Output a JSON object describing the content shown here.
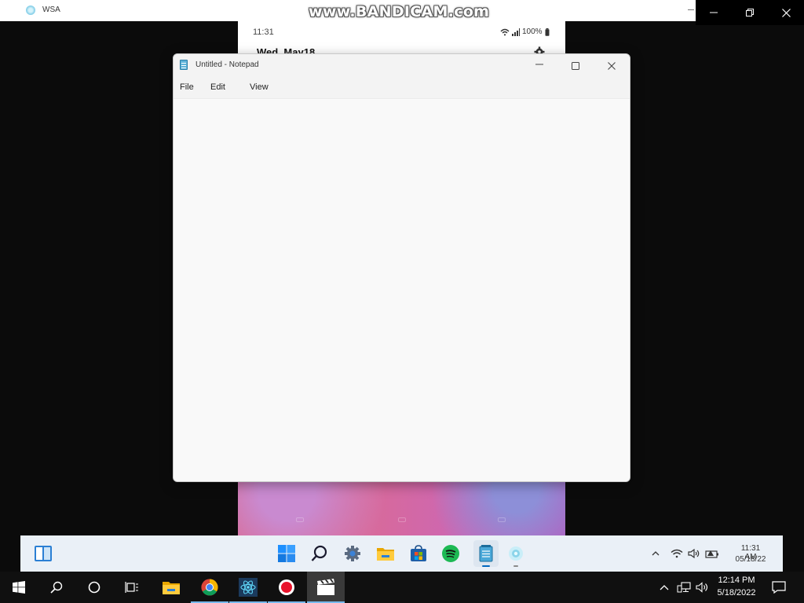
{
  "watermark": "www.BANDICAM.com",
  "wsa": {
    "title": "WSA"
  },
  "android": {
    "time": "11:31",
    "battery": "100%",
    "date": "Wed, May18"
  },
  "notepad": {
    "title": "Untitled - Notepad",
    "menu": [
      "File",
      "Edit",
      "View"
    ],
    "content": ""
  },
  "w11_taskbar": {
    "icons": [
      "widgets-icon",
      "start-icon",
      "search-icon",
      "settings-icon",
      "file-explorer-icon",
      "store-icon",
      "spotify-icon",
      "notepad-icon",
      "wsa-icon"
    ],
    "clock_time": "11:31 AM",
    "clock_date": "05/18/22"
  },
  "w10_taskbar": {
    "clock_time": "12:14 PM",
    "clock_date": "5/18/2022",
    "colors": {
      "accent": "#76b9ed",
      "background": "#101010"
    }
  }
}
